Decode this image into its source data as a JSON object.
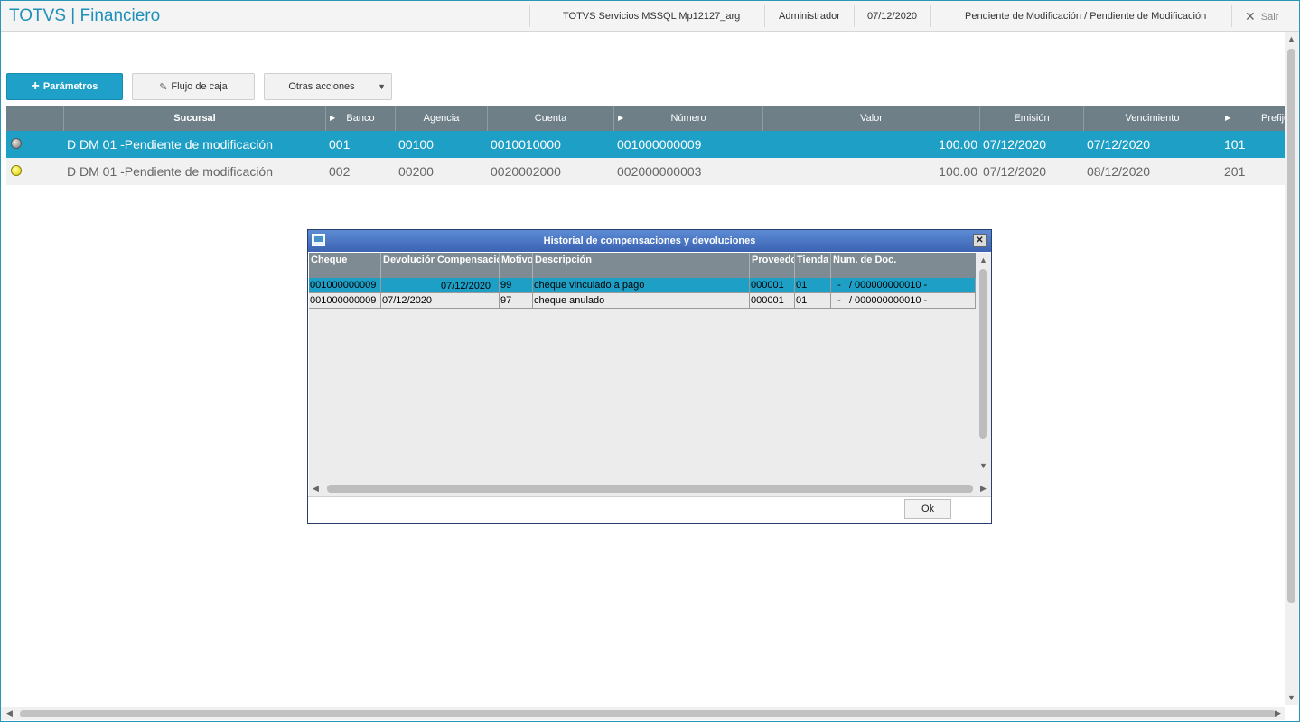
{
  "header": {
    "app_title": "TOTVS | Financiero",
    "environment": "TOTVS Servicios MSSQL Mp12127_arg",
    "user": "Administrador",
    "date": "07/12/2020",
    "status": "Pendiente de Modificación / Pendiente de Modificación",
    "exit_label": "Sair"
  },
  "toolbar": {
    "parametros_label": "Parámetros",
    "flujo_label": "Flujo de caja",
    "otras_label": "Otras acciones"
  },
  "grid": {
    "columns": [
      "Sucursal",
      "Banco",
      "Agencia",
      "Cuenta",
      "Número",
      "Valor",
      "Emisión",
      "Vencimiento",
      "Prefijo"
    ],
    "rows": [
      {
        "status": "gray",
        "sucursal": "D DM 01 -Pendiente de modificación",
        "banco": "001",
        "agencia": "00100",
        "cuenta": "0010010000",
        "numero": "001000000009",
        "valor": "100.00",
        "emision": "07/12/2020",
        "vencimiento": "07/12/2020",
        "prefijo": "101"
      },
      {
        "status": "yellow",
        "sucursal": "D DM 01 -Pendiente de modificación",
        "banco": "002",
        "agencia": "00200",
        "cuenta": "0020002000",
        "numero": "002000000003",
        "valor": "100.00",
        "emision": "07/12/2020",
        "vencimiento": "08/12/2020",
        "prefijo": "201"
      }
    ]
  },
  "dialog": {
    "title": "Historial de compensaciones y devoluciones",
    "columns": [
      "Cheque",
      "Devolución",
      "Compensación",
      "Motivo",
      "Descripción",
      "Proveedor",
      "Tienda",
      "Num. de Doc."
    ],
    "rows": [
      {
        "cheque": "001000000009",
        "devolucion": "",
        "compensacion": "07/12/2020",
        "motivo": "99",
        "descripcion": "cheque vinculado a pago",
        "proveedor": "000001",
        "tienda": "01",
        "num_doc": "  -   / 000000000010 -"
      },
      {
        "cheque": "001000000009",
        "devolucion": "07/12/2020",
        "compensacion": "",
        "motivo": "97",
        "descripcion": "cheque anulado",
        "proveedor": "000001",
        "tienda": "01",
        "num_doc": "  -   / 000000000010 -"
      }
    ],
    "ok_label": "Ok"
  },
  "colors": {
    "accent": "#1e9fc6",
    "header_bg": "#6e7f88",
    "dialog_title": "#3b63b2"
  }
}
